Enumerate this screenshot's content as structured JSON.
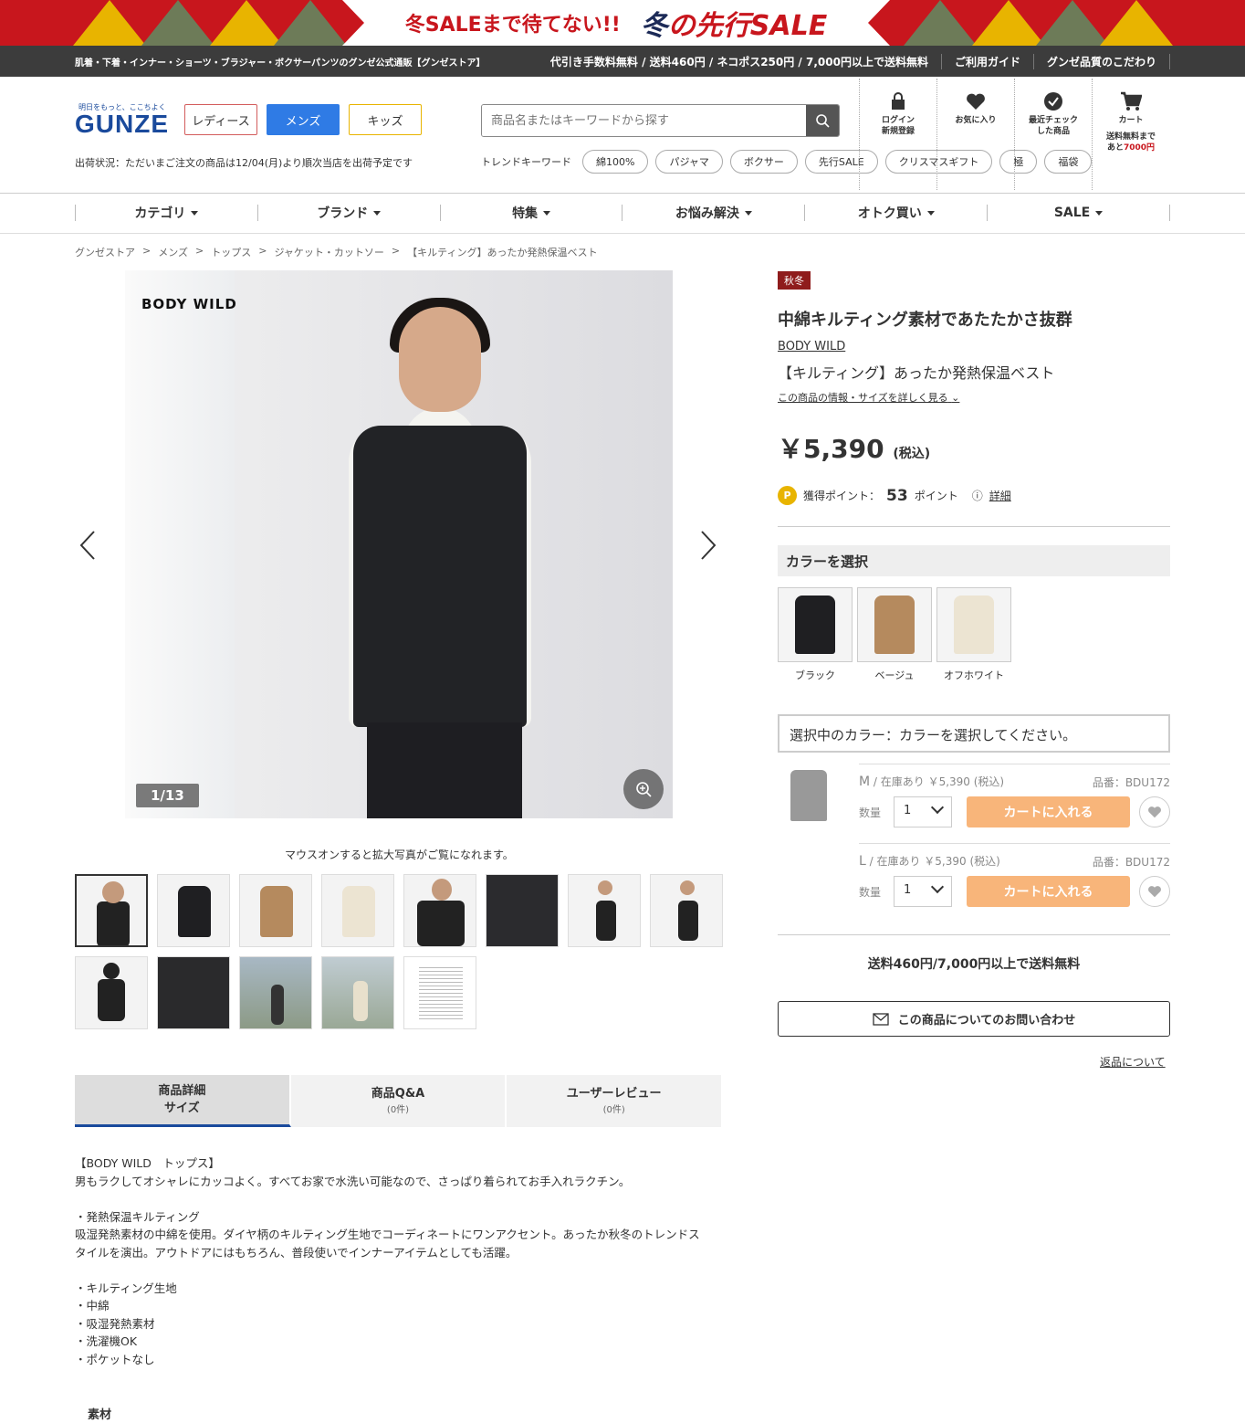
{
  "banner": {
    "text_left": "冬SALEまで待てない!!",
    "text_right_a": "冬",
    "text_right_b": "の先行SALE"
  },
  "infobar": {
    "tagline": "肌着・下着・インナー・ショーツ・ブラジャー・ボクサーパンツのグンゼ公式通販【グンゼストア】",
    "links": [
      "代引き手数料無料 / 送料460円 / ネコポス250円 / 7,000円以上で送料無料",
      "ご利用ガイド",
      "グンゼ品質のこだわり"
    ]
  },
  "header": {
    "logo_tagline": "明日をもっと、ここちよく",
    "logo": "GUNZE",
    "segments": [
      "レディース",
      "メンズ",
      "キッズ"
    ],
    "shipping_notice": "出荷状況：ただいまご注文の商品は12/04(月)より順次当店を出荷予定です",
    "search_placeholder": "商品名またはキーワードから探す",
    "trend_label": "トレンドキーワード",
    "trend_keywords": [
      "綿100%",
      "パジャマ",
      "ボクサー",
      "先行SALE",
      "クリスマスギフト",
      "極",
      "福袋"
    ],
    "icons": [
      {
        "line1": "ログイン",
        "line2": "新規登録"
      },
      {
        "line1": "お気に入り",
        "line2": ""
      },
      {
        "line1": "最近チェック",
        "line2": "した商品"
      },
      {
        "line1": "カート",
        "line2": ""
      }
    ],
    "cart_note_1": "送料無料まで",
    "cart_note_2a": "あと",
    "cart_note_2b": "7000円"
  },
  "nav": [
    "カテゴリ",
    "ブランド",
    "特集",
    "お悩み解決",
    "オトク買い",
    "SALE"
  ],
  "breadcrumb": [
    "グンゼストア",
    ">",
    "メンズ",
    ">",
    "トップス",
    ">",
    "ジャケット・カットソー",
    ">",
    "【キルティング】あったか発熱保温ベスト"
  ],
  "gallery": {
    "brand_logo": "BODY WILD",
    "counter": "1/13",
    "hover_note": "マウスオンすると拡大写真がご覧になれます。"
  },
  "tabs": [
    {
      "l1": "商品詳細",
      "l2": "サイズ"
    },
    {
      "l1": "商品Q&A",
      "l2": "(0件)"
    },
    {
      "l1": "ユーザーレビュー",
      "l2": "(0件)"
    }
  ],
  "description": "【BODY WILD　トップス】\n男もラクしてオシャレにカッコよく。すべてお家で水洗い可能なので、さっぱり着られてお手入れラクチン。\n\n・発熱保温キルティング\n吸湿発熱素材の中綿を使用。ダイヤ柄のキルティング生地でコーディネートにワンアクセント。あったか秋冬のトレンドス\nタイルを演出。アウトドアにはもちろん、普段使いでインナーアイテムとしても活躍。\n\n・キルティング生地\n・中綿\n・吸湿発熱素材\n・洗濯機OK\n・ポケットなし",
  "material_heading": "素材",
  "product": {
    "season": "秋冬",
    "catch": "中綿キルティング素材であたたかさ抜群",
    "brand": "BODY WILD",
    "name": "【キルティング】あったか発熱保温ベスト",
    "detail_link": "この商品の情報・サイズを詳しく見る",
    "price": "￥5,390",
    "tax": "(税込)",
    "point_label": "獲得ポイント：",
    "points": "53",
    "point_unit": "ポイント",
    "point_detail": "詳細",
    "color_heading": "カラーを選択",
    "colors": [
      {
        "name": "ブラック",
        "hex": "#1f1f22"
      },
      {
        "name": "ベージュ",
        "hex": "#b58a5e"
      },
      {
        "name": "オフホワイト",
        "hex": "#ece4d2"
      }
    ],
    "selected_color_text": "選択中のカラー：カラーを選択してください。",
    "skus": [
      {
        "size": "M",
        "stock": " / 在庫あり  ￥5,390 (税込)",
        "code": "品番：BDU172",
        "qty_label": "数量",
        "qty": "1",
        "cart": "カートに入れる"
      },
      {
        "size": "L",
        "stock": " / 在庫あり  ￥5,390 (税込)",
        "code": "品番：BDU172",
        "qty_label": "数量",
        "qty": "1",
        "cart": "カートに入れる"
      }
    ],
    "free_shipping": "送料460円/7,000円以上で送料無料",
    "inquiry": "この商品についてのお問い合わせ",
    "returns": "返品について"
  },
  "colors": {
    "brand_blue": "#1a4a9c",
    "accent_red": "#c8161d",
    "cart_orange": "#f8b57a",
    "mens_blue": "#2f7be5"
  }
}
